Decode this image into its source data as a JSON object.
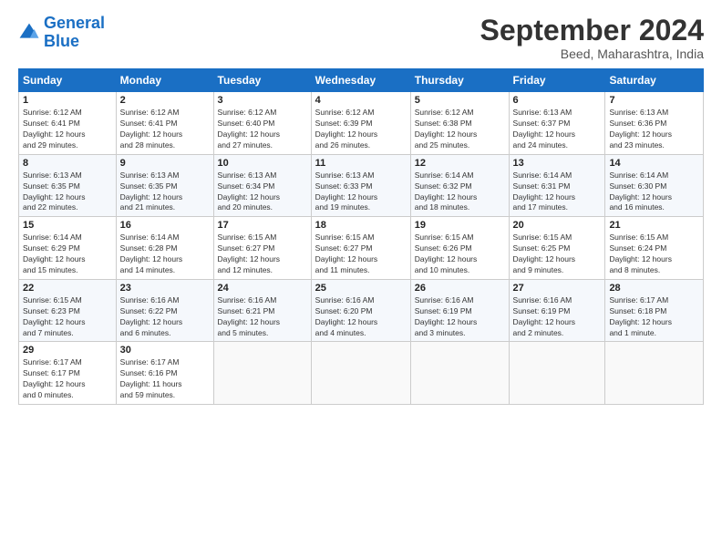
{
  "header": {
    "logo_line1": "General",
    "logo_line2": "Blue",
    "title": "September 2024",
    "location": "Beed, Maharashtra, India"
  },
  "columns": [
    "Sunday",
    "Monday",
    "Tuesday",
    "Wednesday",
    "Thursday",
    "Friday",
    "Saturday"
  ],
  "weeks": [
    [
      {
        "day": "1",
        "info": "Sunrise: 6:12 AM\nSunset: 6:41 PM\nDaylight: 12 hours\nand 29 minutes."
      },
      {
        "day": "2",
        "info": "Sunrise: 6:12 AM\nSunset: 6:41 PM\nDaylight: 12 hours\nand 28 minutes."
      },
      {
        "day": "3",
        "info": "Sunrise: 6:12 AM\nSunset: 6:40 PM\nDaylight: 12 hours\nand 27 minutes."
      },
      {
        "day": "4",
        "info": "Sunrise: 6:12 AM\nSunset: 6:39 PM\nDaylight: 12 hours\nand 26 minutes."
      },
      {
        "day": "5",
        "info": "Sunrise: 6:12 AM\nSunset: 6:38 PM\nDaylight: 12 hours\nand 25 minutes."
      },
      {
        "day": "6",
        "info": "Sunrise: 6:13 AM\nSunset: 6:37 PM\nDaylight: 12 hours\nand 24 minutes."
      },
      {
        "day": "7",
        "info": "Sunrise: 6:13 AM\nSunset: 6:36 PM\nDaylight: 12 hours\nand 23 minutes."
      }
    ],
    [
      {
        "day": "8",
        "info": "Sunrise: 6:13 AM\nSunset: 6:35 PM\nDaylight: 12 hours\nand 22 minutes."
      },
      {
        "day": "9",
        "info": "Sunrise: 6:13 AM\nSunset: 6:35 PM\nDaylight: 12 hours\nand 21 minutes."
      },
      {
        "day": "10",
        "info": "Sunrise: 6:13 AM\nSunset: 6:34 PM\nDaylight: 12 hours\nand 20 minutes."
      },
      {
        "day": "11",
        "info": "Sunrise: 6:13 AM\nSunset: 6:33 PM\nDaylight: 12 hours\nand 19 minutes."
      },
      {
        "day": "12",
        "info": "Sunrise: 6:14 AM\nSunset: 6:32 PM\nDaylight: 12 hours\nand 18 minutes."
      },
      {
        "day": "13",
        "info": "Sunrise: 6:14 AM\nSunset: 6:31 PM\nDaylight: 12 hours\nand 17 minutes."
      },
      {
        "day": "14",
        "info": "Sunrise: 6:14 AM\nSunset: 6:30 PM\nDaylight: 12 hours\nand 16 minutes."
      }
    ],
    [
      {
        "day": "15",
        "info": "Sunrise: 6:14 AM\nSunset: 6:29 PM\nDaylight: 12 hours\nand 15 minutes."
      },
      {
        "day": "16",
        "info": "Sunrise: 6:14 AM\nSunset: 6:28 PM\nDaylight: 12 hours\nand 14 minutes."
      },
      {
        "day": "17",
        "info": "Sunrise: 6:15 AM\nSunset: 6:27 PM\nDaylight: 12 hours\nand 12 minutes."
      },
      {
        "day": "18",
        "info": "Sunrise: 6:15 AM\nSunset: 6:27 PM\nDaylight: 12 hours\nand 11 minutes."
      },
      {
        "day": "19",
        "info": "Sunrise: 6:15 AM\nSunset: 6:26 PM\nDaylight: 12 hours\nand 10 minutes."
      },
      {
        "day": "20",
        "info": "Sunrise: 6:15 AM\nSunset: 6:25 PM\nDaylight: 12 hours\nand 9 minutes."
      },
      {
        "day": "21",
        "info": "Sunrise: 6:15 AM\nSunset: 6:24 PM\nDaylight: 12 hours\nand 8 minutes."
      }
    ],
    [
      {
        "day": "22",
        "info": "Sunrise: 6:15 AM\nSunset: 6:23 PM\nDaylight: 12 hours\nand 7 minutes."
      },
      {
        "day": "23",
        "info": "Sunrise: 6:16 AM\nSunset: 6:22 PM\nDaylight: 12 hours\nand 6 minutes."
      },
      {
        "day": "24",
        "info": "Sunrise: 6:16 AM\nSunset: 6:21 PM\nDaylight: 12 hours\nand 5 minutes."
      },
      {
        "day": "25",
        "info": "Sunrise: 6:16 AM\nSunset: 6:20 PM\nDaylight: 12 hours\nand 4 minutes."
      },
      {
        "day": "26",
        "info": "Sunrise: 6:16 AM\nSunset: 6:19 PM\nDaylight: 12 hours\nand 3 minutes."
      },
      {
        "day": "27",
        "info": "Sunrise: 6:16 AM\nSunset: 6:19 PM\nDaylight: 12 hours\nand 2 minutes."
      },
      {
        "day": "28",
        "info": "Sunrise: 6:17 AM\nSunset: 6:18 PM\nDaylight: 12 hours\nand 1 minute."
      }
    ],
    [
      {
        "day": "29",
        "info": "Sunrise: 6:17 AM\nSunset: 6:17 PM\nDaylight: 12 hours\nand 0 minutes."
      },
      {
        "day": "30",
        "info": "Sunrise: 6:17 AM\nSunset: 6:16 PM\nDaylight: 11 hours\nand 59 minutes."
      },
      {
        "day": "",
        "info": ""
      },
      {
        "day": "",
        "info": ""
      },
      {
        "day": "",
        "info": ""
      },
      {
        "day": "",
        "info": ""
      },
      {
        "day": "",
        "info": ""
      }
    ]
  ]
}
